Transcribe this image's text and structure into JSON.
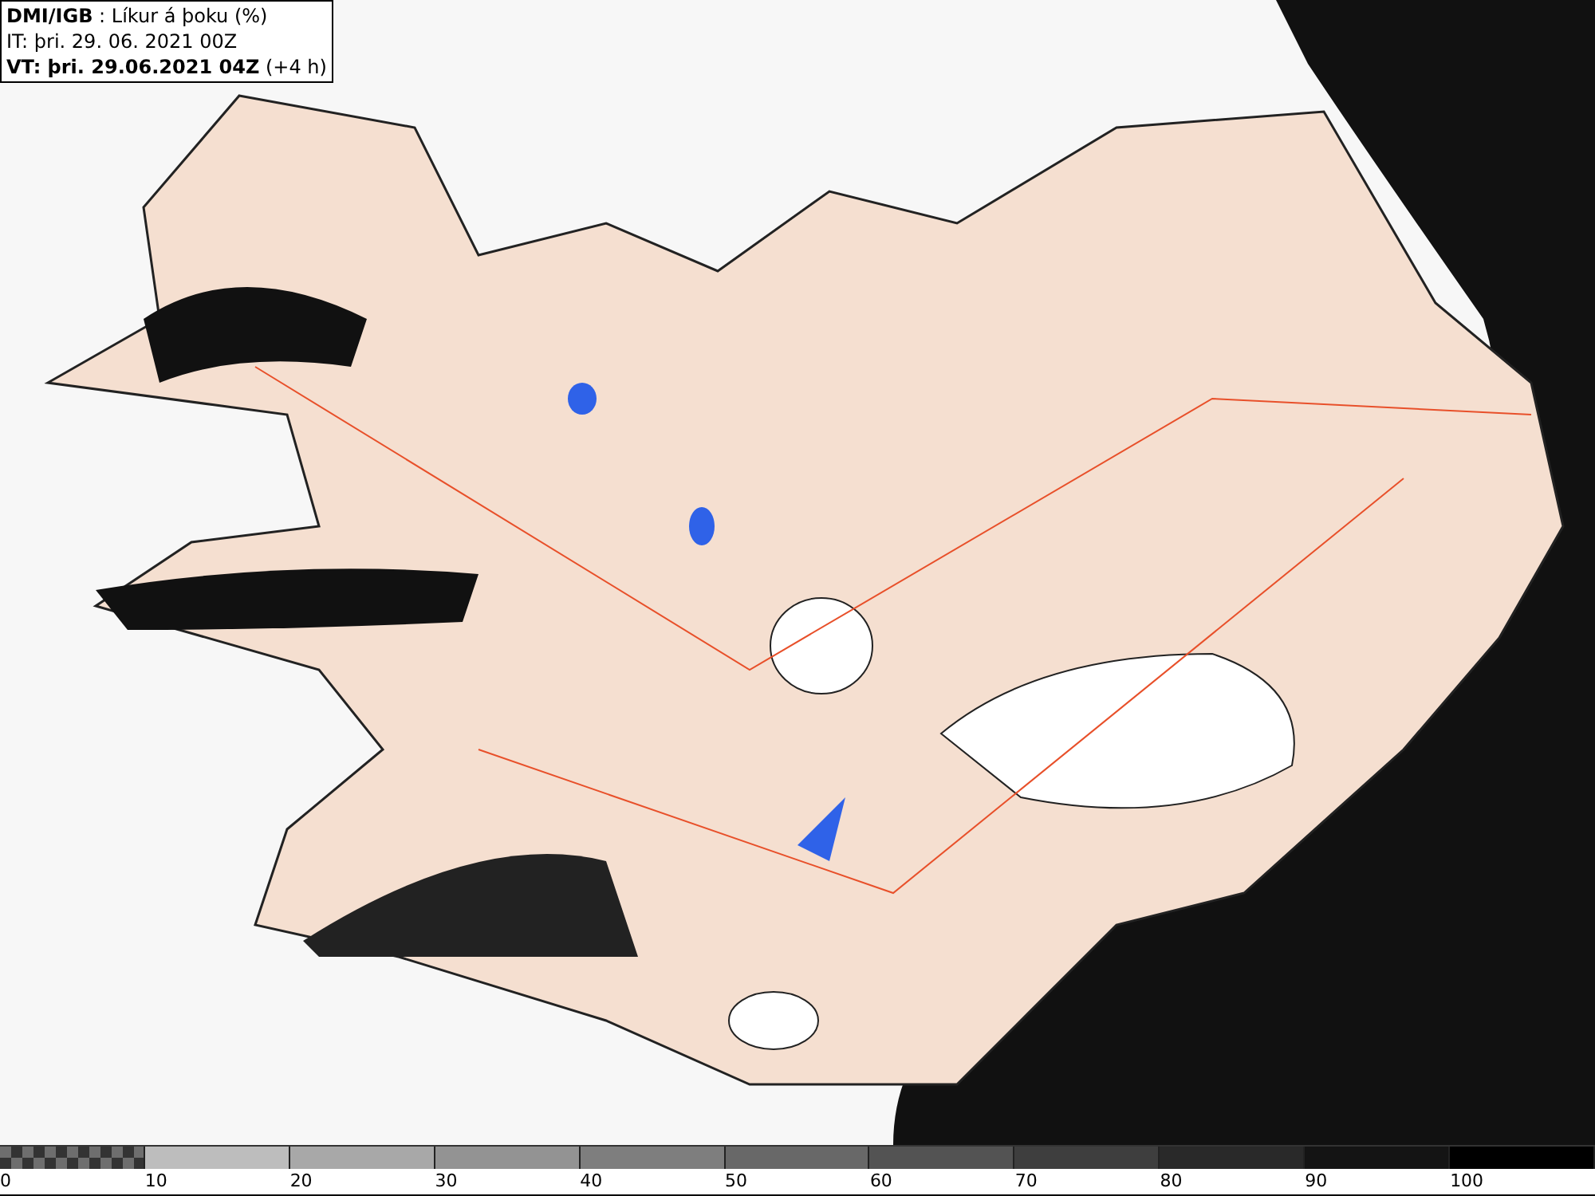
{
  "header": {
    "lines": [
      "**DMI/IGB** : Líkur á þoku (%)",
      "IT: þri. 29. 06. 2021 00Z",
      "**VT: þri. 29.06.2021 04Z** (+4 h)"
    ]
  },
  "legend": [
    {
      "label": "0",
      "kind": "checkered",
      "color": "#6e6e6e"
    },
    {
      "label": "10",
      "kind": "solid",
      "color": "#bdbdbd"
    },
    {
      "label": "20",
      "kind": "solid",
      "color": "#a8a8a8"
    },
    {
      "label": "30",
      "kind": "solid",
      "color": "#939393"
    },
    {
      "label": "40",
      "kind": "solid",
      "color": "#7e7e7e"
    },
    {
      "label": "50",
      "kind": "solid",
      "color": "#686868"
    },
    {
      "label": "60",
      "kind": "solid",
      "color": "#535353"
    },
    {
      "label": "70",
      "kind": "solid",
      "color": "#3e3e3e"
    },
    {
      "label": "80",
      "kind": "solid",
      "color": "#292929"
    },
    {
      "label": "90",
      "kind": "solid",
      "color": "#141414"
    },
    {
      "label": "100",
      "kind": "solid",
      "color": "#000000"
    }
  ]
}
